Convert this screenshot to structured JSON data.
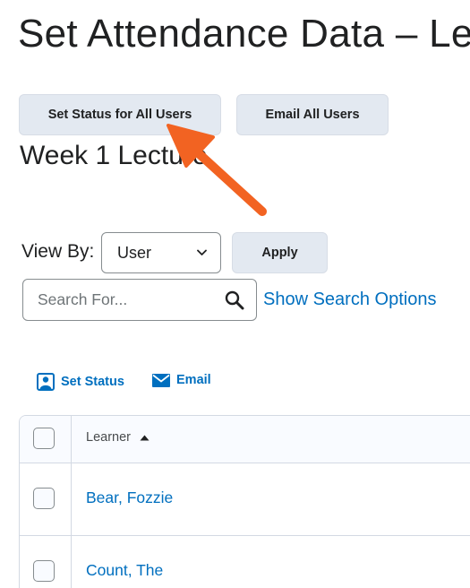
{
  "page": {
    "title": "Set Attendance Data – Lecture"
  },
  "toolbar": {
    "set_status_all_label": "Set Status for All Users",
    "email_all_label": "Email All Users"
  },
  "session": {
    "title": "Week 1 Lecture"
  },
  "view_by": {
    "label": "View By:",
    "selected": "User",
    "apply_label": "Apply"
  },
  "search": {
    "placeholder": "Search For...",
    "value": "",
    "options_link": "Show Search Options"
  },
  "actions": {
    "set_status_label": "Set Status",
    "email_label": "Email"
  },
  "table": {
    "columns": [
      "Learner"
    ],
    "sort": "ascending",
    "rows": [
      {
        "name": "Bear, Fozzie"
      },
      {
        "name": "Count, The"
      }
    ]
  },
  "colors": {
    "link": "#006fbf",
    "button_bg": "#e3e9f1",
    "annotation_arrow": "#f26322"
  }
}
